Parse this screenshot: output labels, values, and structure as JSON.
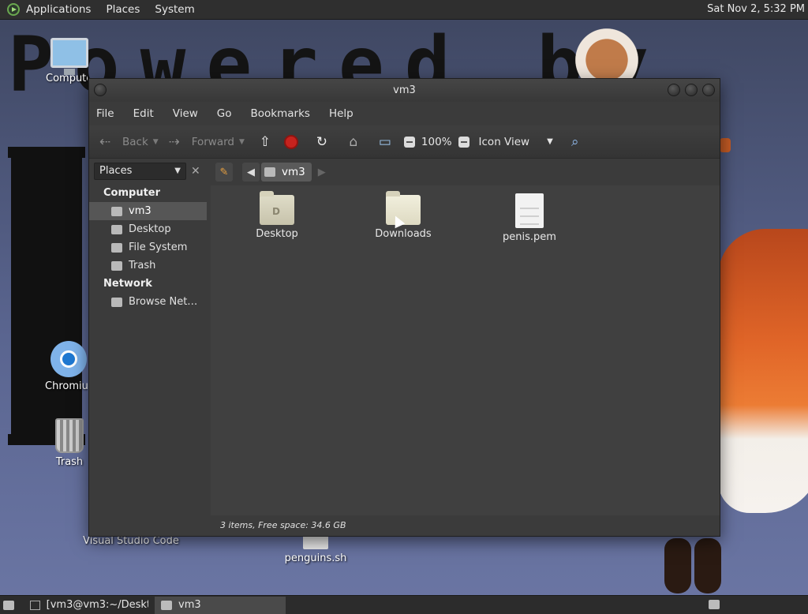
{
  "top_panel": {
    "menus": [
      "Applications",
      "Places",
      "System"
    ],
    "clock": "Sat Nov  2,  5:32 PM"
  },
  "wallpaper": {
    "headline": "Powered by",
    "letter": "L"
  },
  "desktop_icons": {
    "computer": "Computer",
    "chromium": "Chromium",
    "trash": "Trash",
    "vscode": "Visual Studio Code",
    "penguins": "penguins.sh"
  },
  "window": {
    "title": "vm3",
    "menus": [
      "File",
      "Edit",
      "View",
      "Go",
      "Bookmarks",
      "Help"
    ],
    "toolbar": {
      "back": "Back",
      "forward": "Forward",
      "zoom": "100%",
      "view_mode": "Icon View"
    },
    "sidebar": {
      "selector": "Places",
      "sections": [
        {
          "label": "Computer",
          "items": [
            "vm3",
            "Desktop",
            "File System",
            "Trash"
          ]
        },
        {
          "label": "Network",
          "items": [
            "Browse Net…"
          ]
        }
      ],
      "selected": "vm3"
    },
    "pathbar": {
      "crumb": "vm3"
    },
    "files": [
      {
        "name": "Desktop",
        "type": "folder"
      },
      {
        "name": "Downloads",
        "type": "folder"
      },
      {
        "name": "penis.pem",
        "type": "document"
      }
    ],
    "status": "3 items, Free space: 34.6 GB"
  },
  "taskbar": {
    "items": [
      "[vm3@vm3:~/Deskt…",
      "vm3"
    ]
  }
}
